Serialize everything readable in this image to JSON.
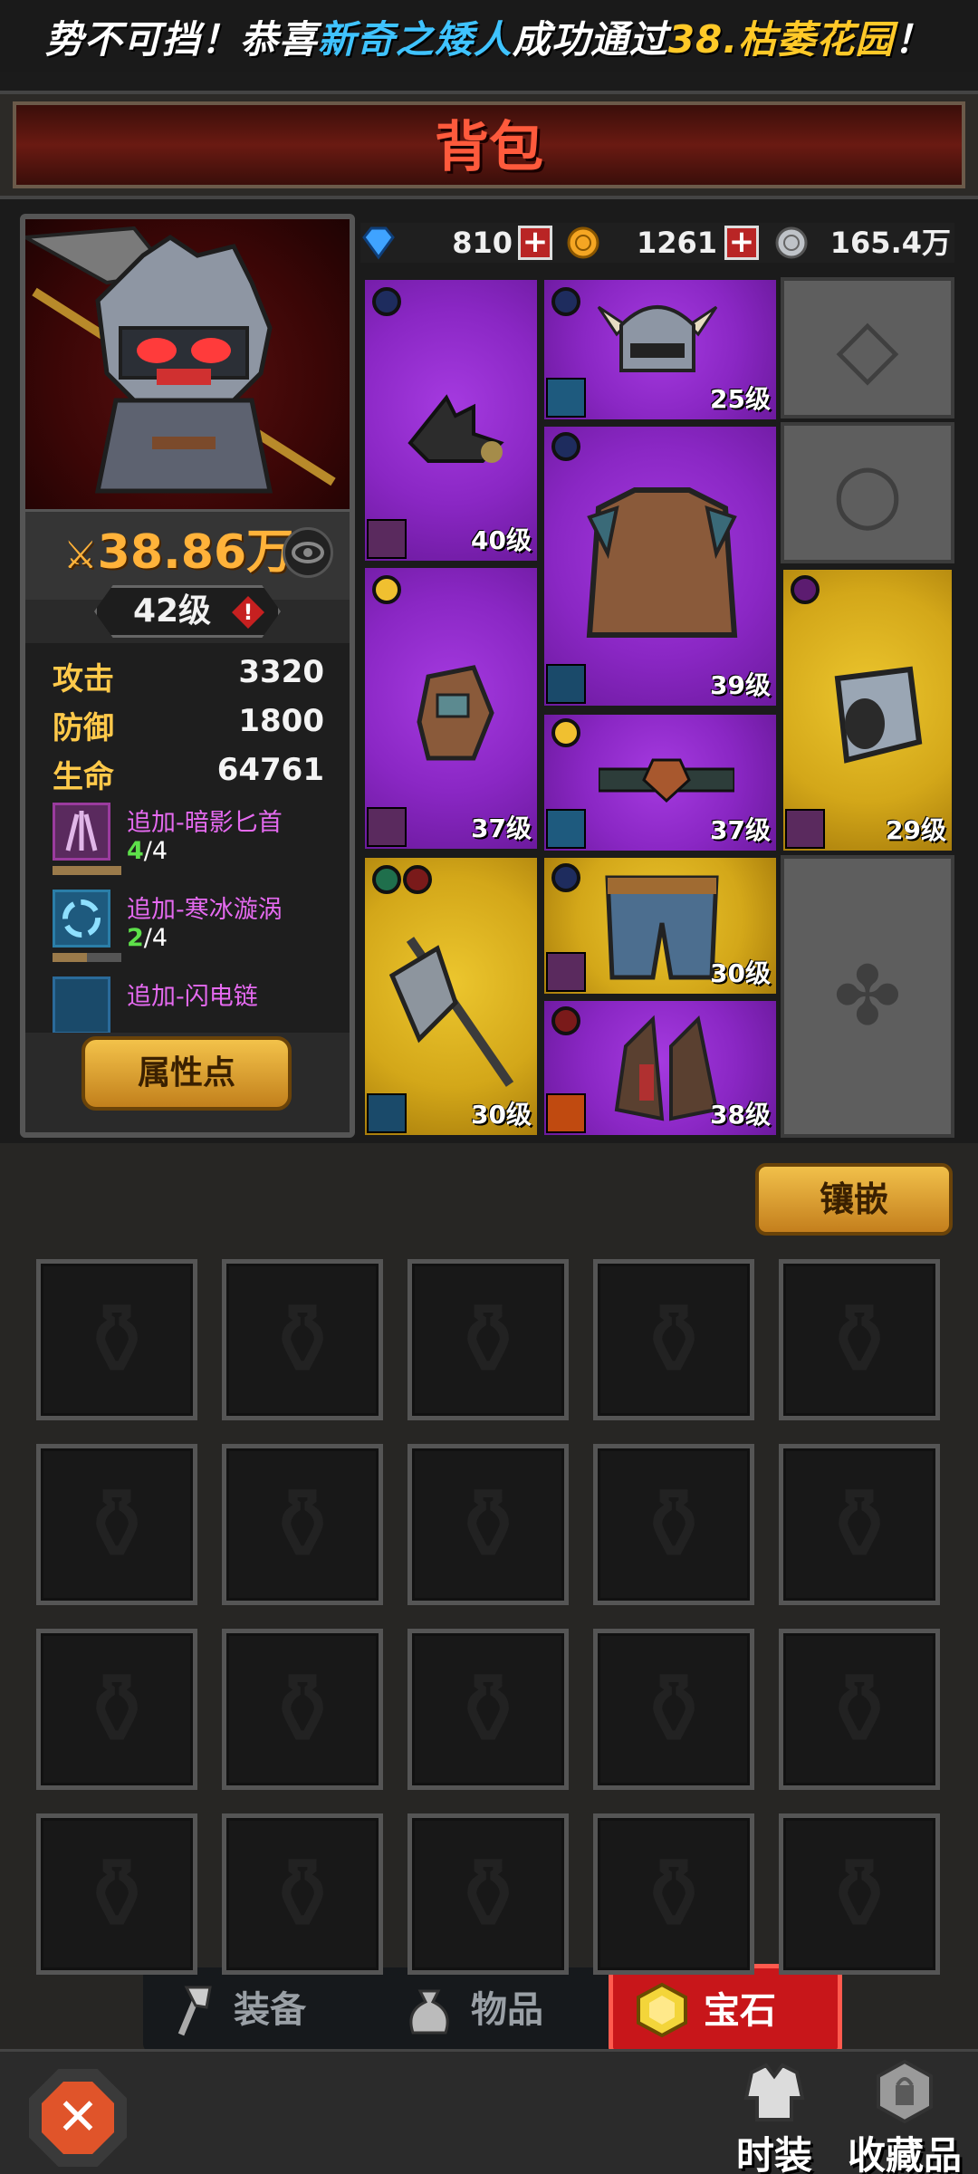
{
  "banner": {
    "prefix": "势不可挡！恭喜",
    "player": "新奇之矮人",
    "middle": "成功通过",
    "stage": "38.枯萎花园",
    "suffix": "！"
  },
  "title": "背包",
  "hero": {
    "power": "38.86万",
    "level": "42级",
    "alert": "!",
    "stats": [
      {
        "label": "攻击",
        "value": "3320"
      },
      {
        "label": "防御",
        "value": "1800"
      },
      {
        "label": "生命",
        "value": "64761"
      }
    ],
    "bonuses": [
      {
        "name": "追加-暗影匕首",
        "current": "4",
        "total": "/4",
        "icon": "shadow-dagger-icon"
      },
      {
        "name": "追加-寒冰漩涡",
        "current": "2",
        "total": "/4",
        "icon": "ice-vortex-icon"
      },
      {
        "name": "追加-闪电链",
        "current": "",
        "total": "",
        "icon": "lightning-chain-icon"
      }
    ],
    "attr_button": "属性点"
  },
  "currency": {
    "diamond": "810",
    "gold": "1261",
    "silver": "165.4万"
  },
  "equipment": [
    {
      "name": "claw",
      "level": "40级",
      "rarity": "purple"
    },
    {
      "name": "helmet",
      "level": "25级",
      "rarity": "purple"
    },
    {
      "name": "armor",
      "level": "39级",
      "rarity": "purple"
    },
    {
      "name": "glove",
      "level": "37级",
      "rarity": "purple"
    },
    {
      "name": "belt",
      "level": "37级",
      "rarity": "purple"
    },
    {
      "name": "bracer",
      "level": "29级",
      "rarity": "gold"
    },
    {
      "name": "axe",
      "level": "30级",
      "rarity": "gold"
    },
    {
      "name": "pants",
      "level": "30级",
      "rarity": "gold"
    },
    {
      "name": "boots",
      "level": "38级",
      "rarity": "purple"
    }
  ],
  "inlay_button": "镶嵌",
  "tabs": [
    {
      "label": "装备",
      "icon": "axe-icon"
    },
    {
      "label": "物品",
      "icon": "bag-icon"
    },
    {
      "label": "宝石",
      "icon": "gem-icon"
    }
  ],
  "nav": [
    {
      "label": "时装",
      "icon": "costume-icon"
    },
    {
      "label": "收藏品",
      "icon": "collection-icon"
    }
  ],
  "colors": {
    "purple_rarity": "#8a27c4",
    "gold_rarity": "#d3a719",
    "active_tab": "#c8161a",
    "highlight_blue": "#3fc3ff",
    "highlight_gold": "#ffc928"
  }
}
